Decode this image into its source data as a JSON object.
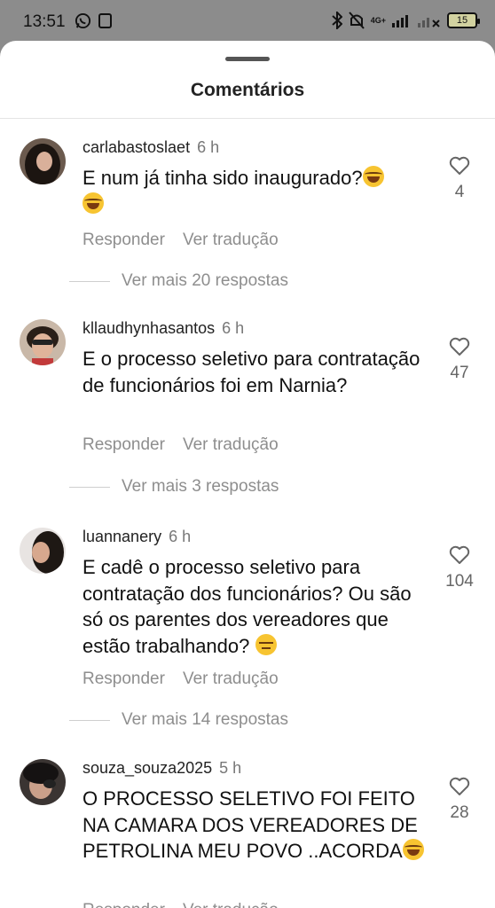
{
  "status": {
    "time": "13:51",
    "network": "4G+",
    "battery": "15"
  },
  "sheet": {
    "title": "Comentários"
  },
  "comments": [
    {
      "username": "carlabastoslaet",
      "time": "6 h",
      "text": "E num já tinha sido inaugurado?",
      "likes": "4",
      "reply": "Responder",
      "translate": "Ver tradução",
      "more": "Ver mais 20 respostas"
    },
    {
      "username": "kllaudhynhasantos",
      "time": "6 h",
      "text": "E o processo seletivo para contratação de funcionários foi em Narnia?",
      "likes": "47",
      "reply": "Responder",
      "translate": "Ver tradução",
      "more": "Ver mais 3 respostas"
    },
    {
      "username": "luannanery",
      "time": "6 h",
      "text": "E cadê o processo seletivo para contratação dos funcionários? Ou são só os parentes dos vereadores que estão trabalhando?",
      "likes": "104",
      "reply": "Responder",
      "translate": "Ver tradução",
      "more": "Ver mais 14 respostas"
    },
    {
      "username": "souza_souza2025",
      "time": "5 h",
      "text": "O PROCESSO SELETIVO FOI FEITO NA CAMARA DOS VEREADORES DE PETROLINA MEU POVO ..ACORDA",
      "likes": "28",
      "reply": "Responder",
      "translate": "Ver tradução"
    }
  ],
  "colors": {
    "sheet_bg": "#ffffff",
    "muted": "#8e8e8e",
    "scrim": "#8c8c8c"
  },
  "icons": [
    "whatsapp-icon",
    "notification-icon",
    "bluetooth-icon",
    "mute-icon",
    "signal-icon",
    "wifi-off-icon",
    "battery-icon",
    "heart-icon"
  ]
}
